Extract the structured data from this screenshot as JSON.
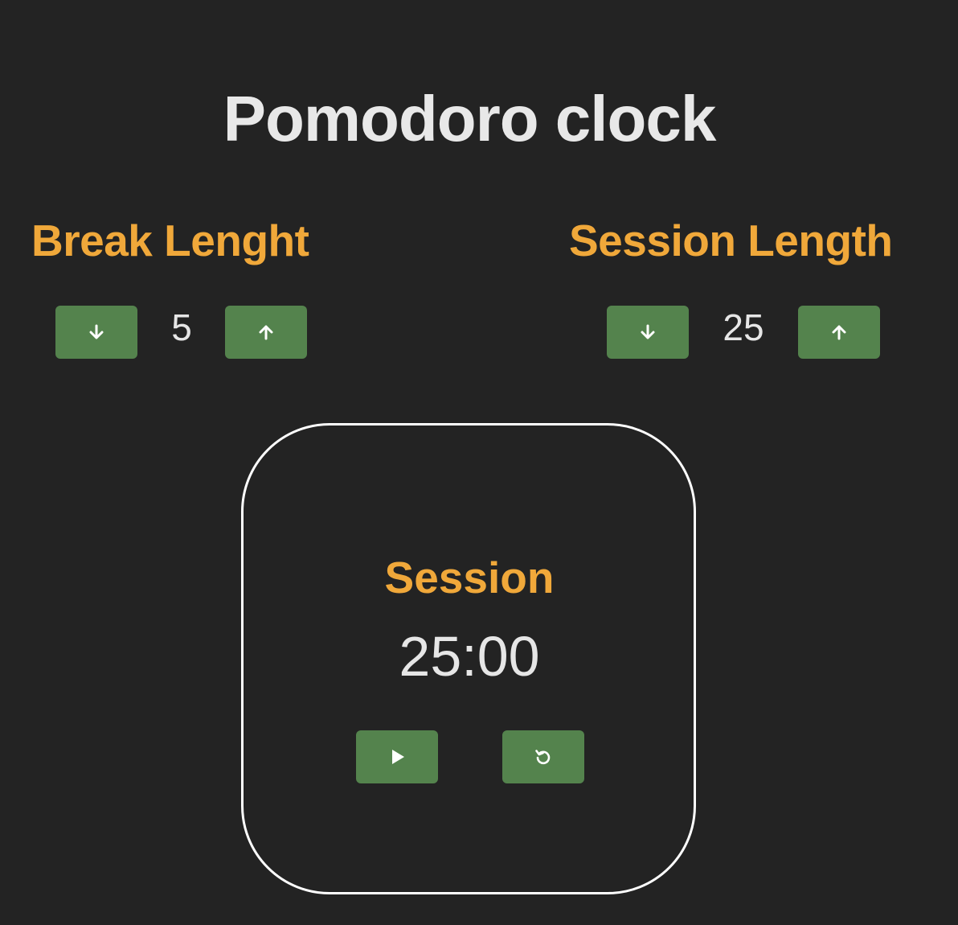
{
  "app": {
    "title": "Pomodoro clock"
  },
  "break": {
    "label": "Break Lenght",
    "value": "5",
    "decrement_icon": "arrow-down-icon",
    "increment_icon": "arrow-up-icon"
  },
  "session": {
    "label": "Session Length",
    "value": "25",
    "decrement_icon": "arrow-down-icon",
    "increment_icon": "arrow-up-icon"
  },
  "timer": {
    "label": "Session",
    "time_left": "25:00",
    "start_icon": "play-icon",
    "reset_icon": "reset-icon"
  },
  "colors": {
    "background": "#232323",
    "accent": "#f0a83a",
    "button": "#54834d",
    "text": "#e6e6e6",
    "border": "#ffffff"
  }
}
